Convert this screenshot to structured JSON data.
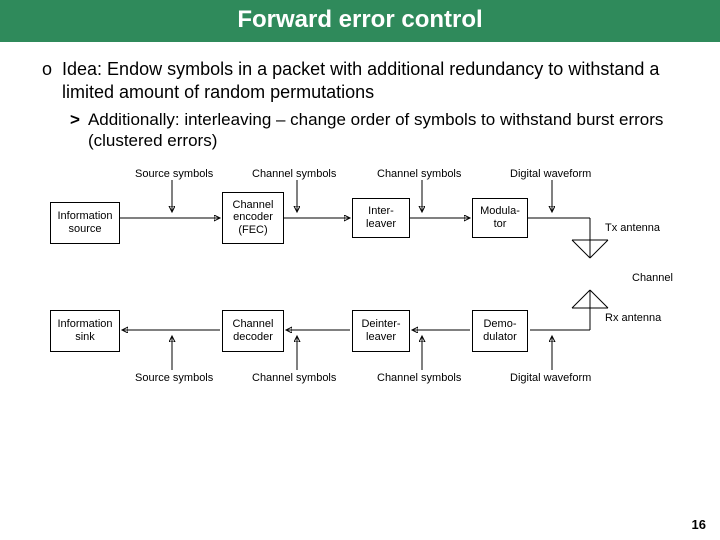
{
  "title": "Forward error control",
  "bullet": {
    "marker": "o",
    "text": "Idea: Endow symbols in a packet with additional redundancy to withstand a limited amount of random permutations"
  },
  "subbullet": {
    "marker": ">",
    "text": "Additionally: interleaving – change order of symbols to withstand burst errors (clustered errors)"
  },
  "diagram": {
    "top_labels": {
      "l1": "Source symbols",
      "l2": "Channel symbols",
      "l3": "Channel symbols",
      "l4": "Digital waveform"
    },
    "bot_labels": {
      "l1": "Source symbols",
      "l2": "Channel symbols",
      "l3": "Channel symbols",
      "l4": "Digital waveform"
    },
    "boxes": {
      "src": "Information\nsource",
      "enc": "Channel\nencoder\n(FEC)",
      "intl": "Inter-\nleaver",
      "mod": "Modula-\ntor",
      "sink": "Information\nsink",
      "dec": "Channel\ndecoder",
      "deintl": "Deinter-\nleaver",
      "demod": "Demo-\ndulator"
    },
    "tx": "Tx antenna",
    "rx": "Rx antenna",
    "channel": "Channel"
  },
  "page": "16"
}
